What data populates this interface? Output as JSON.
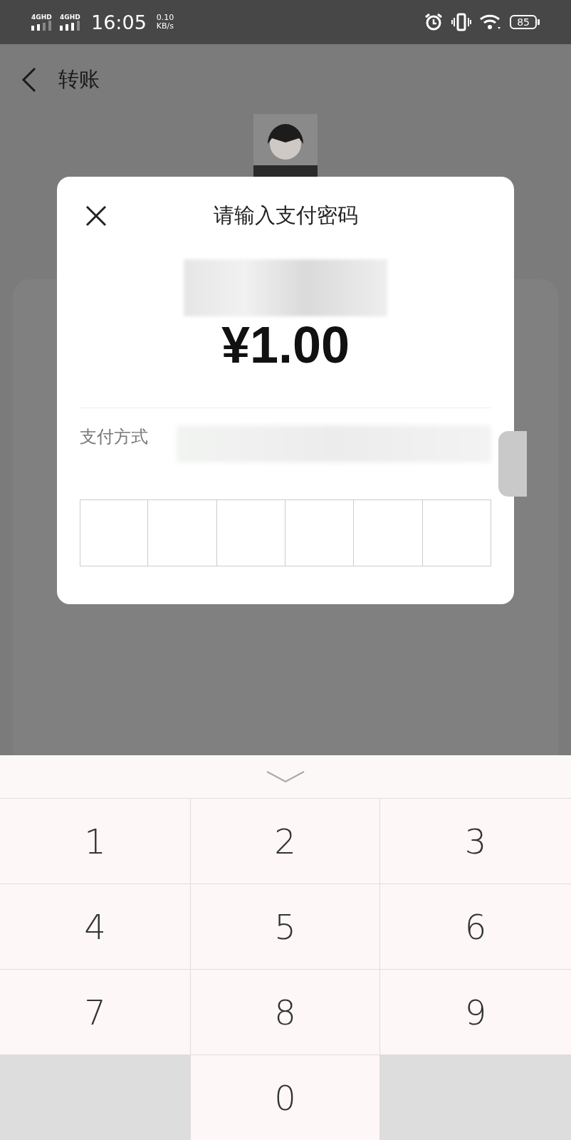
{
  "status_bar": {
    "signals": [
      {
        "label": "4GHD"
      },
      {
        "label": "4GHD"
      }
    ],
    "time": "16:05",
    "net_speed": "0.10",
    "net_unit": "KB/s",
    "battery": "85"
  },
  "header": {
    "title": "转账"
  },
  "dialog": {
    "title": "请输入支付密码",
    "amount": "¥1.00",
    "payment_method_label": "支付方式",
    "pin_cells": [
      {
        "filled": false
      },
      {
        "filled": false
      },
      {
        "filled": false
      },
      {
        "filled": false
      },
      {
        "filled": false
      },
      {
        "filled": false
      }
    ]
  },
  "keypad": {
    "keys": [
      {
        "kind": "digit",
        "label": "1"
      },
      {
        "kind": "digit",
        "label": "2"
      },
      {
        "kind": "digit",
        "label": "3"
      },
      {
        "kind": "digit",
        "label": "4"
      },
      {
        "kind": "digit",
        "label": "5"
      },
      {
        "kind": "digit",
        "label": "6"
      },
      {
        "kind": "digit",
        "label": "7"
      },
      {
        "kind": "digit",
        "label": "8"
      },
      {
        "kind": "digit",
        "label": "9"
      },
      {
        "kind": "blank"
      },
      {
        "kind": "digit",
        "label": "0"
      },
      {
        "kind": "blank"
      }
    ]
  }
}
